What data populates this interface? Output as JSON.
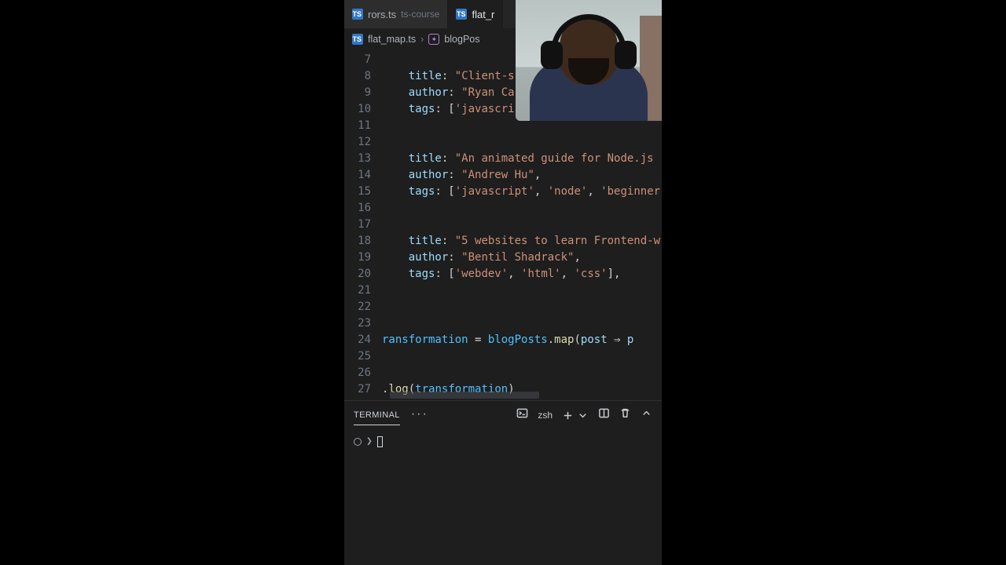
{
  "ts_badge": "TS",
  "tabs": {
    "inactive": {
      "file": "rors.ts",
      "folder": "ts-course"
    },
    "active": {
      "file": "flat_r"
    }
  },
  "breadcrumb": {
    "file": "flat_map.ts",
    "symbol": "blogPos"
  },
  "editor": {
    "lines": [
      {
        "n": 7,
        "kind": "blank"
      },
      {
        "n": 8,
        "kind": "kv",
        "key": "title",
        "val": "\"Client-s"
      },
      {
        "n": 9,
        "kind": "kv",
        "key": "author",
        "val": "\"Ryan Ca"
      },
      {
        "n": 10,
        "kind": "tags",
        "items": [
          "'javascri"
        ],
        "close": ""
      },
      {
        "n": 11,
        "kind": "blank"
      },
      {
        "n": 12,
        "kind": "blank"
      },
      {
        "n": 13,
        "kind": "kv",
        "key": "title",
        "val": "\"An animated guide for Node.js "
      },
      {
        "n": 14,
        "kind": "kv",
        "key": "author",
        "val": "\"Andrew Hu\"",
        "comma": true
      },
      {
        "n": 15,
        "kind": "tags",
        "items": [
          "'javascript'",
          "'node'",
          "'beginner"
        ],
        "close": ""
      },
      {
        "n": 16,
        "kind": "blank"
      },
      {
        "n": 17,
        "kind": "blank"
      },
      {
        "n": 18,
        "kind": "kv",
        "key": "title",
        "val": "\"5 websites to learn Frontend-w"
      },
      {
        "n": 19,
        "kind": "kv",
        "key": "author",
        "val": "\"Bentil Shadrack\"",
        "comma": true
      },
      {
        "n": 20,
        "kind": "tags",
        "items": [
          "'webdev'",
          "'html'",
          "'css'"
        ],
        "close": "],"
      },
      {
        "n": 21,
        "kind": "blank"
      },
      {
        "n": 22,
        "kind": "blank"
      },
      {
        "n": 23,
        "kind": "blank"
      },
      {
        "n": 24,
        "kind": "map"
      },
      {
        "n": 25,
        "kind": "blank"
      },
      {
        "n": 26,
        "kind": "blank"
      },
      {
        "n": 27,
        "kind": "log"
      }
    ],
    "map": {
      "lhs": "ransformation",
      "obj": "blogPosts",
      "fn": "map",
      "arg": "post",
      "tail": "p"
    },
    "log": {
      "fn": "log",
      "arg": "transformation"
    }
  },
  "terminal": {
    "tab": "TERMINAL",
    "shell": "zsh",
    "prompt": "❯"
  }
}
